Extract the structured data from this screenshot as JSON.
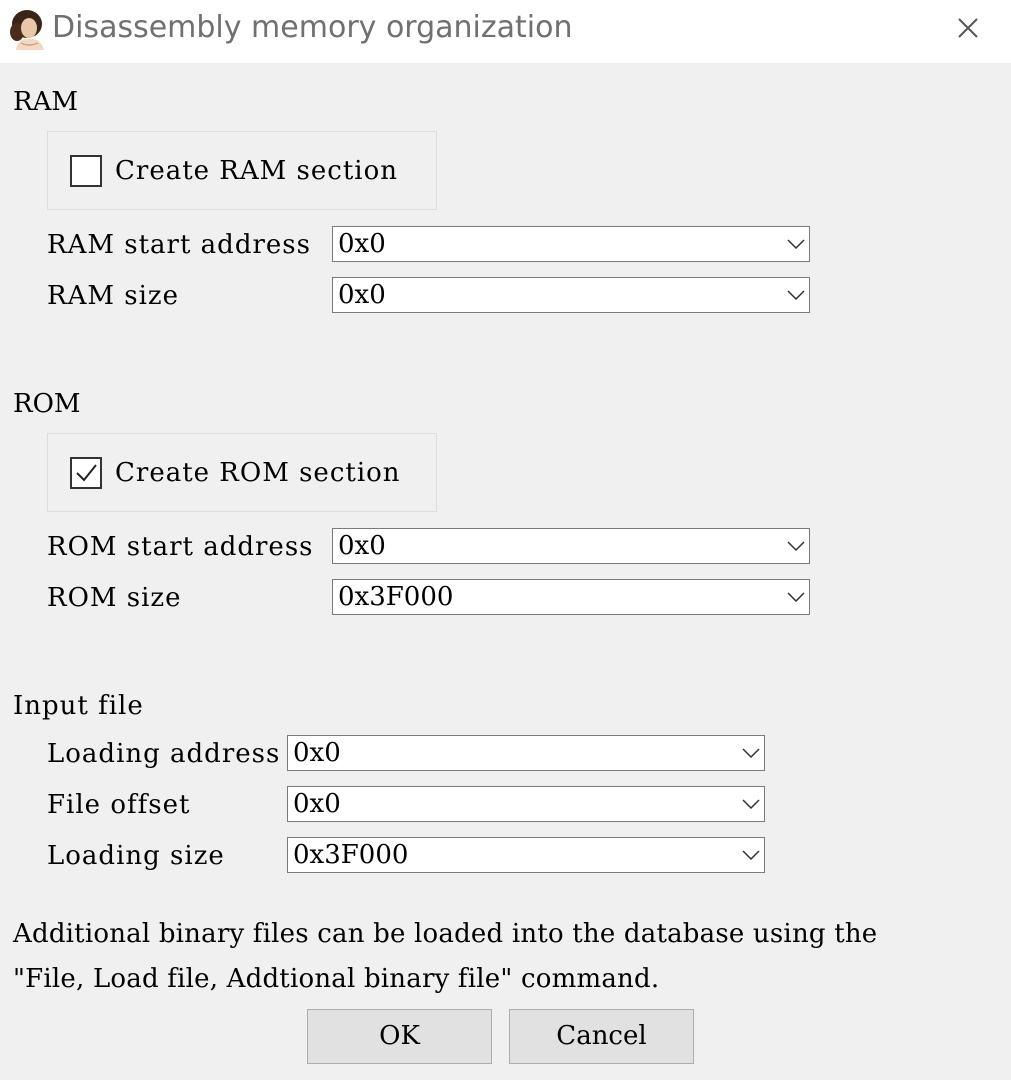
{
  "window": {
    "title": "Disassembly memory organization",
    "icon": "app-portrait-icon"
  },
  "ram": {
    "group_label": "RAM",
    "create_section": {
      "label": "Create RAM section",
      "checked": false
    },
    "start_address": {
      "label": "RAM start address",
      "value": "0x0"
    },
    "size": {
      "label": "RAM size",
      "value": "0x0"
    }
  },
  "rom": {
    "group_label": "ROM",
    "create_section": {
      "label": "Create ROM section",
      "checked": true
    },
    "start_address": {
      "label": "ROM start address",
      "value": "0x0"
    },
    "size": {
      "label": "ROM size",
      "value": "0x3F000"
    }
  },
  "input_file": {
    "group_label": "Input file",
    "loading_address": {
      "label": "Loading address",
      "value": "0x0"
    },
    "file_offset": {
      "label": "File offset",
      "value": "0x0"
    },
    "loading_size": {
      "label": "Loading size",
      "value": "0x3F000"
    }
  },
  "info": {
    "line1": "Additional binary files can be loaded into the database using the",
    "line2": "\"File, Load file, Addtional binary file\" command."
  },
  "buttons": {
    "ok": "OK",
    "cancel": "Cancel"
  }
}
